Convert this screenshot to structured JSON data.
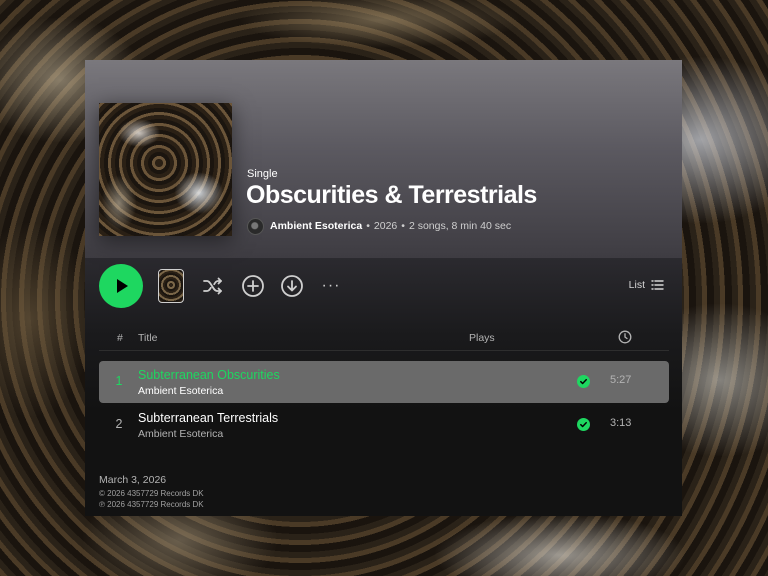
{
  "album": {
    "type_label": "Single",
    "title": "Obscurities & Terrestrials",
    "artist": "Ambient Esoterica",
    "year": "2026",
    "summary": "2 songs, 8 min 40 sec",
    "separator": "•"
  },
  "controls": {
    "view_label": "List",
    "more_label": "···"
  },
  "columns": {
    "number": "#",
    "title": "Title",
    "plays": "Plays"
  },
  "tracks": [
    {
      "number": "1",
      "title": "Subterranean Obscurities",
      "artist": "Ambient Esoterica",
      "duration": "5:27"
    },
    {
      "number": "2",
      "title": "Subterranean Terrestrials",
      "artist": "Ambient Esoterica",
      "duration": "3:13"
    }
  ],
  "footer": {
    "release_date": "March 3, 2026",
    "copyright": "© 2026 4357729 Records DK",
    "phonographic": "℗ 2026 4357729 Records DK"
  },
  "colors": {
    "accent": "#1ed760",
    "background": "#121212",
    "active_row": "#6a6a6a"
  },
  "icons": [
    "play-icon",
    "shuffle-icon",
    "add-circle-icon",
    "download-circle-icon",
    "more-options-icon",
    "list-view-icon",
    "clock-icon",
    "downloaded-check-icon"
  ]
}
